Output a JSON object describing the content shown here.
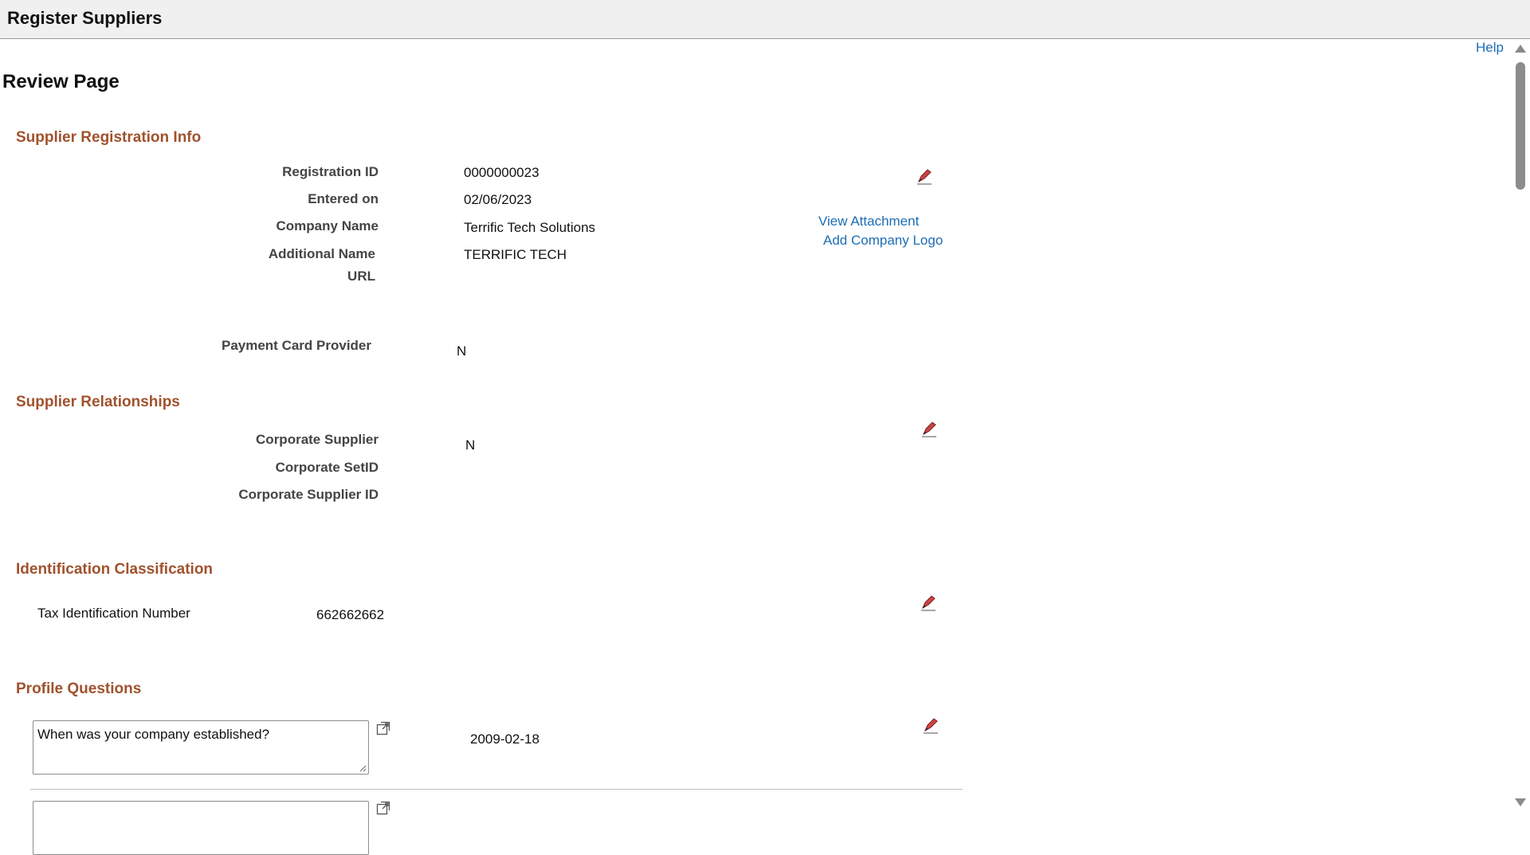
{
  "header": {
    "title": "Register Suppliers"
  },
  "help_link": "Help",
  "page_title": "Review Page",
  "registration": {
    "section_title": "Supplier Registration Info",
    "registration_id_label": "Registration ID",
    "registration_id": "0000000023",
    "entered_on_label": "Entered on",
    "entered_on": "02/06/2023",
    "company_name_label": "Company Name",
    "company_name": "Terrific Tech Solutions",
    "additional_name_label": "Additional Name",
    "additional_name": "TERRIFIC TECH",
    "url_label": "URL",
    "view_attachment": "View Attachment",
    "add_company_logo": "Add Company Logo",
    "payment_card_label": "Payment Card Provider",
    "payment_card": "N"
  },
  "relationships": {
    "section_title": "Supplier Relationships",
    "corporate_supplier_label": "Corporate Supplier",
    "corporate_supplier": "N",
    "corporate_setid_label": "Corporate SetID",
    "corporate_supplier_id_label": "Corporate Supplier ID"
  },
  "identification": {
    "section_title": "Identification Classification",
    "tax_id_label": "Tax Identification Number",
    "tax_id": "662662662"
  },
  "profile": {
    "section_title": "Profile Questions",
    "questions": [
      {
        "question": "When was your company established?",
        "answer": "2009-02-18"
      }
    ]
  },
  "icons": {
    "edit": "edit-pencil-icon",
    "expand": "expand-icon"
  },
  "colors": {
    "section": "#a0522d",
    "link": "#1c6db4",
    "label": "#444444"
  }
}
